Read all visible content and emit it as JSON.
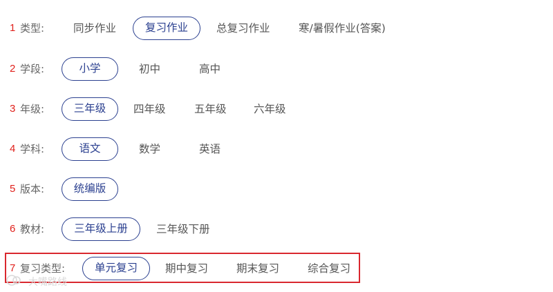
{
  "rows": [
    {
      "num": "1",
      "label": "类型:",
      "options": [
        "同步作业",
        "复习作业",
        "总复习作业",
        "寒/暑假作业(答案)"
      ],
      "selected": "复习作业"
    },
    {
      "num": "2",
      "label": "学段:",
      "options": [
        "小学",
        "初中",
        "高中"
      ],
      "selected": "小学"
    },
    {
      "num": "3",
      "label": "年级:",
      "options": [
        "三年级",
        "四年级",
        "五年级",
        "六年级"
      ],
      "selected": "三年级"
    },
    {
      "num": "4",
      "label": "学科:",
      "options": [
        "语文",
        "数学",
        "英语"
      ],
      "selected": "语文"
    },
    {
      "num": "5",
      "label": "版本:",
      "options": [
        "统编版"
      ],
      "selected": "统编版"
    },
    {
      "num": "6",
      "label": "教材:",
      "options": [
        "三年级上册",
        "三年级下册"
      ],
      "selected": "三年级上册"
    },
    {
      "num": "7",
      "label": "复习类型:",
      "options": [
        "单元复习",
        "期中复习",
        "期末复习",
        "综合复习"
      ],
      "selected": "单元复习"
    }
  ],
  "watermark": {
    "text": "大嘴路线",
    "icon": "watermark-logo-icon"
  },
  "colors": {
    "selected": "#2a3f8f",
    "step_number": "#e0201b",
    "highlight_border": "#d9272e",
    "label": "#666666",
    "option": "#555555"
  }
}
